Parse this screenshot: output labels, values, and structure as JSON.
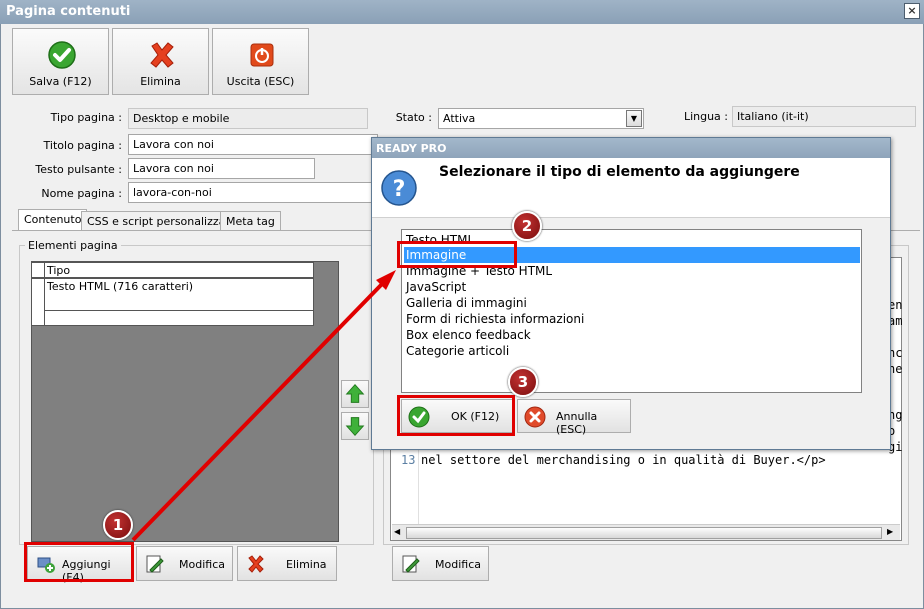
{
  "window": {
    "title": "Pagina contenuti"
  },
  "toolbar": {
    "save_label": "Salva (F12)",
    "delete_label": "Elimina",
    "exit_label": "Uscita (ESC)"
  },
  "form": {
    "page_type_label": "Tipo pagina :",
    "page_type_value": "Desktop e mobile",
    "state_label": "Stato :",
    "state_value": "Attiva",
    "language_label": "Lingua :",
    "language_value": "Italiano (it-it)",
    "title_label": "Titolo pagina :",
    "title_value": "Lavora con noi",
    "button_text_label": "Testo pulsante :",
    "button_text_value": "Lavora con noi",
    "page_name_label": "Nome pagina :",
    "page_name_value": "lavora-con-noi"
  },
  "tabs": [
    "Contenuto",
    "CSS e script personalizzati",
    "Meta tag"
  ],
  "elements": {
    "group_label": "Elementi pagina",
    "column_header": "Tipo",
    "rows": [
      "Testo HTML (716 caratteri)"
    ]
  },
  "bottom_buttons": {
    "add_label": "Aggiungi (F4)",
    "edit_label": "Modifica",
    "delete_label": "Elimina",
    "edit_right_label": "Modifica"
  },
  "code": {
    "line_number": "13",
    "line_text": "nel settore del merchandising o in qualità di Buyer.</p>",
    "partial_chars": [
      "en",
      "am",
      "nc",
      "ne",
      "ng",
      "o",
      "gi"
    ]
  },
  "dialog": {
    "title": "READY PRO",
    "heading": "Selezionare il tipo di elemento da aggiungere",
    "items": [
      "Testo HTML",
      "Immagine",
      "Immagine + Testo HTML",
      "JavaScript",
      "Galleria di immagini",
      "Form di richiesta informazioni",
      "Box elenco feedback",
      "Categorie articoli"
    ],
    "selected_index": 1,
    "ok_label": "OK (F12)",
    "cancel_label": "Annulla (ESC)"
  },
  "annotations": {
    "step1": "1",
    "step2": "2",
    "step3": "3"
  },
  "colors": {
    "highlight": "#e00000",
    "selection": "#3399ff"
  }
}
